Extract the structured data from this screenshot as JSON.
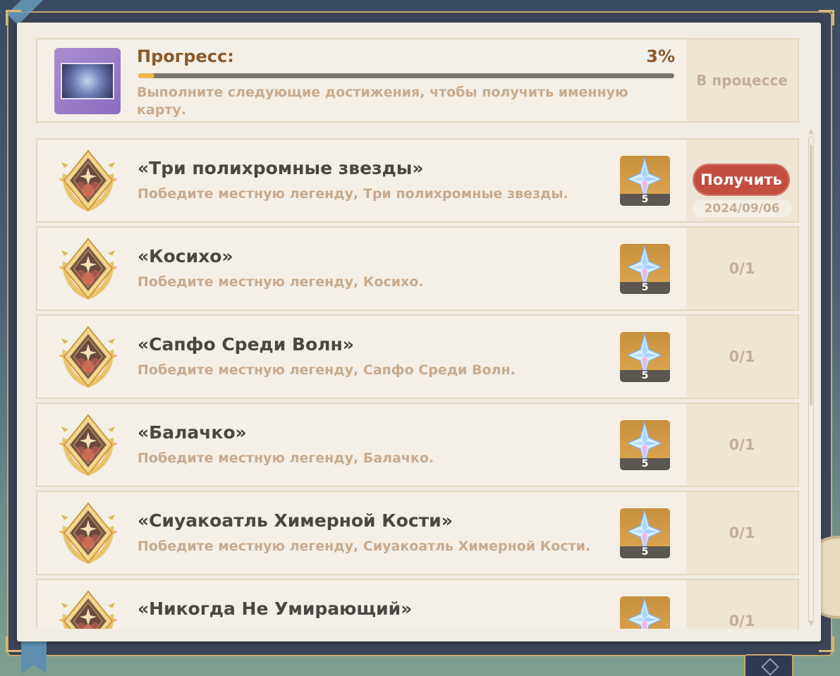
{
  "header": {
    "progress_label": "Прогресс:",
    "progress_percent": "3%",
    "progress_value": 0.03,
    "description": "Выполните следующие достижения, чтобы получить именную карту.",
    "status": "В процессе"
  },
  "achievements": [
    {
      "title": "«Три полихромные звезды»",
      "description": "Победите местную легенду, Три полихромные звезды.",
      "reward_count": "5",
      "claim_label": "Получить",
      "date": "2024/09/06"
    },
    {
      "title": "«Косихо»",
      "description": "Победите местную легенду, Косихо.",
      "reward_count": "5",
      "progress": "0/1"
    },
    {
      "title": "«Сапфо Среди Волн»",
      "description": "Победите местную легенду, Сапфо Среди Волн.",
      "reward_count": "5",
      "progress": "0/1"
    },
    {
      "title": "«Балачко»",
      "description": "Победите местную легенду, Балачко.",
      "reward_count": "5",
      "progress": "0/1"
    },
    {
      "title": "«Сиуакоатль Химерной Кости»",
      "description": "Победите местную легенду, Сиуакоатль Химерной Кости.",
      "reward_count": "5",
      "progress": "0/1"
    },
    {
      "title": "«Никогда Не Умирающий»",
      "description": "",
      "reward_count": "",
      "progress": "0/1"
    }
  ],
  "colors": {
    "accent": "#8a5a2b",
    "claim": "#c44d42",
    "progress_fill": "#f0b44a"
  },
  "icons": {
    "achievement": "laurel-medal-icon",
    "reward": "primogem-icon",
    "namecard": "namecard-icon"
  }
}
